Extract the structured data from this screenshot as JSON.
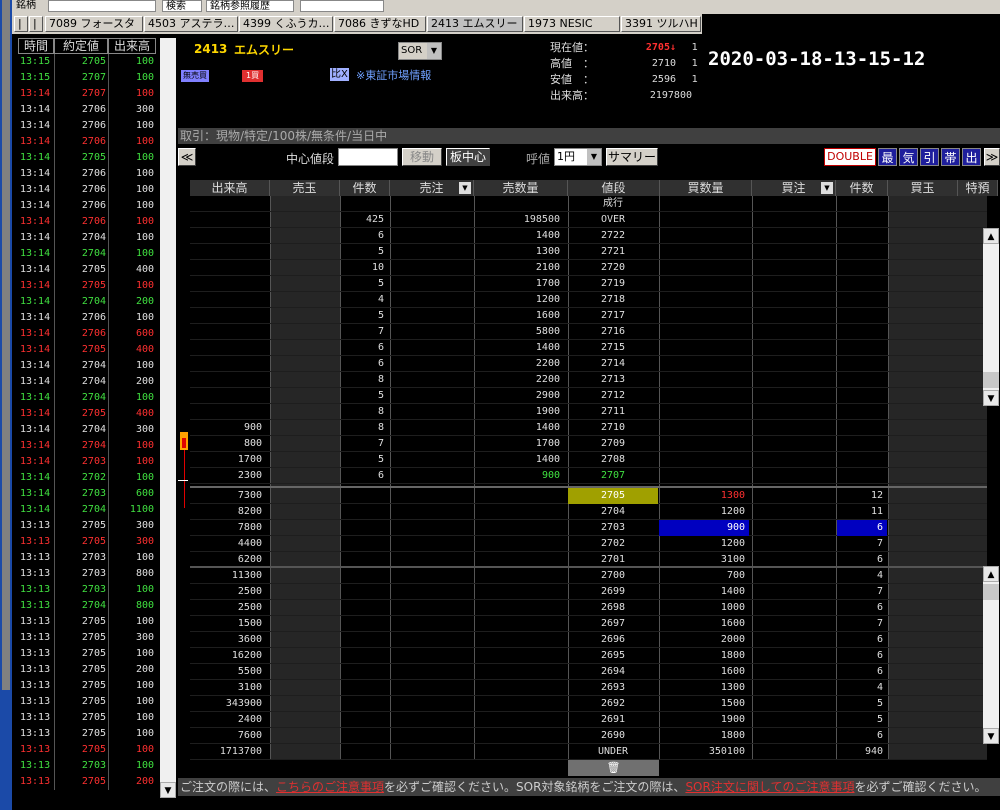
{
  "topbar": {
    "symbol_label": "銘柄",
    "search_label": "検索",
    "history_label": "銘柄参照履歴"
  },
  "tabs": [
    "7089 フォースタ",
    "4503 アステラ…",
    "4399 くふうカ…",
    "7086 きずなHD",
    "2413 エムスリー",
    "1973 NESIC",
    "3391 ツルハH"
  ],
  "tab_nav": [
    "|",
    "|"
  ],
  "ticks": {
    "headers": [
      "時間",
      "約定値",
      "出来高"
    ],
    "rows": [
      [
        "13:15",
        "2705",
        "100",
        "g"
      ],
      [
        "13:15",
        "2707",
        "100",
        "g"
      ],
      [
        "13:14",
        "2707",
        "100",
        "r"
      ],
      [
        "13:14",
        "2706",
        "300",
        "w"
      ],
      [
        "13:14",
        "2706",
        "100",
        "w"
      ],
      [
        "13:14",
        "2706",
        "100",
        "r"
      ],
      [
        "13:14",
        "2705",
        "100",
        "g"
      ],
      [
        "13:14",
        "2706",
        "100",
        "w"
      ],
      [
        "13:14",
        "2706",
        "100",
        "w"
      ],
      [
        "13:14",
        "2706",
        "100",
        "w"
      ],
      [
        "13:14",
        "2706",
        "100",
        "r"
      ],
      [
        "13:14",
        "2704",
        "100",
        "w"
      ],
      [
        "13:14",
        "2704",
        "100",
        "g"
      ],
      [
        "13:14",
        "2705",
        "400",
        "w"
      ],
      [
        "13:14",
        "2705",
        "100",
        "r"
      ],
      [
        "13:14",
        "2704",
        "200",
        "g"
      ],
      [
        "13:14",
        "2706",
        "100",
        "w"
      ],
      [
        "13:14",
        "2706",
        "600",
        "r"
      ],
      [
        "13:14",
        "2705",
        "400",
        "r"
      ],
      [
        "13:14",
        "2704",
        "100",
        "w"
      ],
      [
        "13:14",
        "2704",
        "200",
        "w"
      ],
      [
        "13:14",
        "2704",
        "100",
        "g"
      ],
      [
        "13:14",
        "2705",
        "400",
        "r"
      ],
      [
        "13:14",
        "2704",
        "300",
        "w"
      ],
      [
        "13:14",
        "2704",
        "100",
        "r"
      ],
      [
        "13:14",
        "2703",
        "100",
        "r"
      ],
      [
        "13:14",
        "2702",
        "100",
        "g"
      ],
      [
        "13:14",
        "2703",
        "600",
        "g"
      ],
      [
        "13:14",
        "2704",
        "1100",
        "g"
      ],
      [
        "13:13",
        "2705",
        "300",
        "w"
      ],
      [
        "13:13",
        "2705",
        "300",
        "r"
      ],
      [
        "13:13",
        "2703",
        "100",
        "w"
      ],
      [
        "13:13",
        "2703",
        "800",
        "w"
      ],
      [
        "13:13",
        "2703",
        "100",
        "g"
      ],
      [
        "13:13",
        "2704",
        "800",
        "g"
      ],
      [
        "13:13",
        "2705",
        "100",
        "w"
      ],
      [
        "13:13",
        "2705",
        "300",
        "w"
      ],
      [
        "13:13",
        "2705",
        "100",
        "w"
      ],
      [
        "13:13",
        "2705",
        "200",
        "w"
      ],
      [
        "13:13",
        "2705",
        "100",
        "w"
      ],
      [
        "13:13",
        "2705",
        "100",
        "w"
      ],
      [
        "13:13",
        "2705",
        "100",
        "w"
      ],
      [
        "13:13",
        "2705",
        "100",
        "w"
      ],
      [
        "13:13",
        "2705",
        "100",
        "r"
      ],
      [
        "13:13",
        "2703",
        "100",
        "g"
      ],
      [
        "13:13",
        "2705",
        "200",
        "r"
      ]
    ]
  },
  "info": {
    "code": "2413",
    "name": "エムスリー",
    "market_select": "SOR",
    "badge_unlimited": "無売買",
    "badge_lot": "1買",
    "market_info_icon": "比X",
    "market_info_label": "※東証市場情報",
    "labels": [
      "現在値：",
      "高値　：",
      "安値　：",
      "出来高："
    ],
    "values": [
      "2705↓",
      "2710",
      "2596",
      "2197800"
    ],
    "suffix": [
      "1",
      "1",
      "1"
    ]
  },
  "timestamp": "2020-03-18-13-15-12",
  "tradebar": "取引：現物/特定/100株/無条件/当日中",
  "controls": {
    "center_price_label": "中心値段",
    "center_price_value": "",
    "move_button": "移動",
    "board_center_button": "板中心",
    "tick_label": "呼値",
    "tick_value": "1円",
    "summary_button": "サマリー",
    "double_button": "DOUBLE",
    "icon_buttons": [
      "最",
      "気",
      "引",
      "帯",
      "出"
    ],
    "nav_left": "≪",
    "nav_right": "≫"
  },
  "book": {
    "headers": [
      "出来高",
      "売玉",
      "件数",
      "売注",
      "売数量",
      "値段",
      "買数量",
      "買注",
      "件数",
      "買玉",
      "特預"
    ],
    "market_order_label": "成行",
    "over": {
      "count": "425",
      "qty": "198500",
      "label": "OVER"
    },
    "asks": [
      {
        "price": "2722",
        "qty": "1400",
        "count": "6",
        "vol": ""
      },
      {
        "price": "2721",
        "qty": "1300",
        "count": "5",
        "vol": ""
      },
      {
        "price": "2720",
        "qty": "2100",
        "count": "10",
        "vol": ""
      },
      {
        "price": "2719",
        "qty": "1700",
        "count": "5",
        "vol": ""
      },
      {
        "price": "2718",
        "qty": "1200",
        "count": "4",
        "vol": ""
      },
      {
        "price": "2717",
        "qty": "1600",
        "count": "5",
        "vol": ""
      },
      {
        "price": "2716",
        "qty": "5800",
        "count": "7",
        "vol": ""
      },
      {
        "price": "2715",
        "qty": "1400",
        "count": "6",
        "vol": ""
      },
      {
        "price": "2714",
        "qty": "2200",
        "count": "6",
        "vol": ""
      },
      {
        "price": "2713",
        "qty": "2200",
        "count": "8",
        "vol": ""
      },
      {
        "price": "2712",
        "qty": "2900",
        "count": "5",
        "vol": ""
      },
      {
        "price": "2711",
        "qty": "1900",
        "count": "8",
        "vol": ""
      },
      {
        "price": "2710",
        "qty": "1400",
        "count": "8",
        "vol": "900"
      },
      {
        "price": "2709",
        "qty": "1700",
        "count": "7",
        "vol": "800"
      },
      {
        "price": "2708",
        "qty": "1400",
        "count": "5",
        "vol": "1700"
      },
      {
        "price": "2707",
        "qty": "900",
        "count": "6",
        "vol": "2300"
      }
    ],
    "bids": [
      {
        "price": "2705",
        "qty": "1300",
        "count": "12",
        "vol": "7300"
      },
      {
        "price": "2704",
        "qty": "1200",
        "count": "11",
        "vol": "8200"
      },
      {
        "price": "2703",
        "qty": "900",
        "count": "6",
        "vol": "7800"
      },
      {
        "price": "2702",
        "qty": "1200",
        "count": "7",
        "vol": "4400"
      },
      {
        "price": "2701",
        "qty": "3100",
        "count": "6",
        "vol": "6200"
      },
      {
        "price": "2700",
        "qty": "700",
        "count": "4",
        "vol": "11300"
      },
      {
        "price": "2699",
        "qty": "1400",
        "count": "7",
        "vol": "2500"
      },
      {
        "price": "2698",
        "qty": "1000",
        "count": "6",
        "vol": "2500"
      },
      {
        "price": "2697",
        "qty": "1600",
        "count": "7",
        "vol": "1500"
      },
      {
        "price": "2696",
        "qty": "2000",
        "count": "6",
        "vol": "3600"
      },
      {
        "price": "2695",
        "qty": "1800",
        "count": "6",
        "vol": "16200"
      },
      {
        "price": "2694",
        "qty": "1600",
        "count": "6",
        "vol": "5500"
      },
      {
        "price": "2693",
        "qty": "1300",
        "count": "4",
        "vol": "3100"
      },
      {
        "price": "2692",
        "qty": "1500",
        "count": "5",
        "vol": "343900"
      },
      {
        "price": "2691",
        "qty": "1900",
        "count": "5",
        "vol": "2400"
      },
      {
        "price": "2690",
        "qty": "1800",
        "count": "6",
        "vol": "7600"
      }
    ],
    "under": {
      "vol": "1713700",
      "label": "UNDER",
      "qty": "350100",
      "count": "940"
    },
    "trash_icon": "🗑"
  },
  "footer": {
    "t1": "ご注文の際には、",
    "link1": "こちらのご注意事項",
    "t2": "を必ずご確認ください。SOR対象銘柄をご注文の際は、",
    "link2": "SOR注文に関してのご注意事項",
    "t3": "を必ずご確認ください。"
  },
  "colors": {
    "up": "#40e040",
    "down": "#ff3030",
    "neutral": "#e0e0e0",
    "current_price_bg": "#a0a000",
    "highlight_bid": "#0000c0"
  }
}
